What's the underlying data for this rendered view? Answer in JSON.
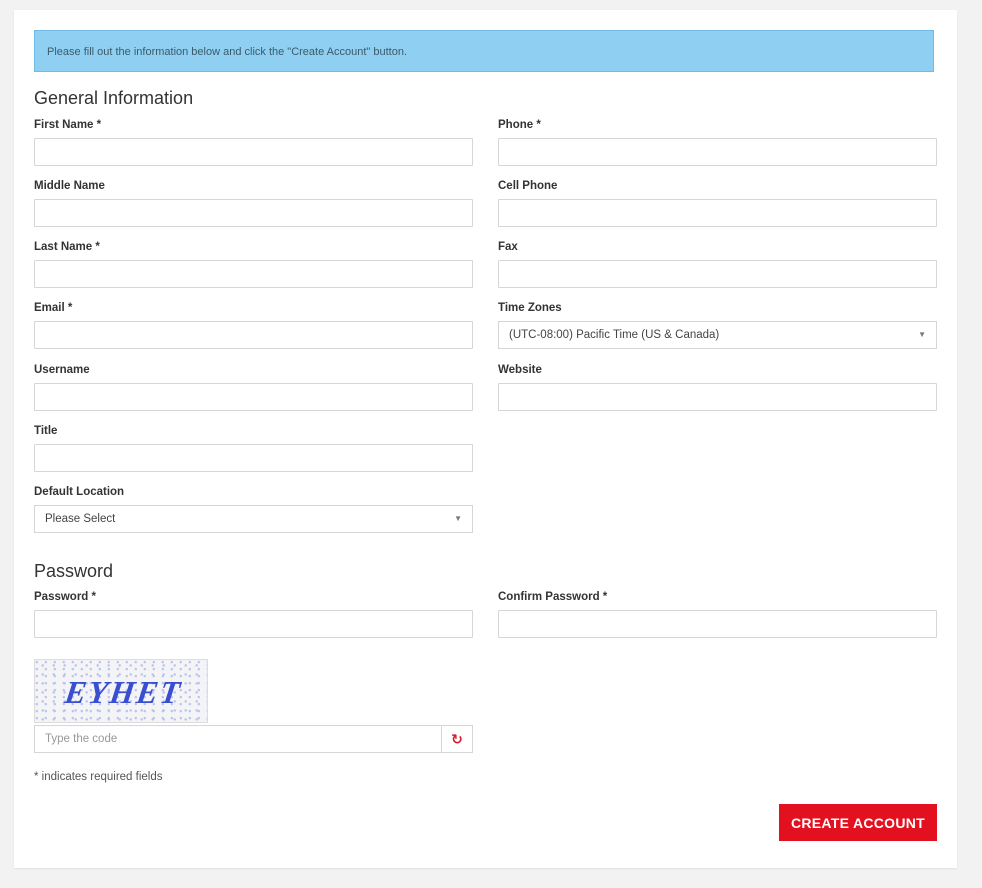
{
  "notice": "Please fill out the information below and click the \"Create Account\" button.",
  "general_heading": "General Information",
  "fields": {
    "first_name": {
      "label": "First Name *",
      "value": ""
    },
    "middle_name": {
      "label": "Middle Name",
      "value": ""
    },
    "last_name": {
      "label": "Last Name *",
      "value": ""
    },
    "email": {
      "label": "Email *",
      "value": ""
    },
    "username": {
      "label": "Username",
      "value": ""
    },
    "title": {
      "label": "Title",
      "value": ""
    },
    "default_location": {
      "label": "Default Location",
      "selected": "Please Select"
    },
    "phone": {
      "label": "Phone *",
      "value": ""
    },
    "cell_phone": {
      "label": "Cell Phone",
      "value": ""
    },
    "fax": {
      "label": "Fax",
      "value": ""
    },
    "time_zones": {
      "label": "Time Zones",
      "selected": "(UTC-08:00) Pacific Time (US & Canada)"
    },
    "website": {
      "label": "Website",
      "value": ""
    }
  },
  "password_heading": "Password",
  "password": {
    "label": "Password *",
    "value": ""
  },
  "confirm_password": {
    "label": "Confirm Password *",
    "value": ""
  },
  "captcha": {
    "image_text": "EYHET",
    "placeholder": "Type the code",
    "refresh_icon": "refresh-icon"
  },
  "required_note": "* indicates required fields",
  "create_button": "CREATE ACCOUNT",
  "colors": {
    "notice_bg": "#8fd0f2",
    "accent": "#e3101f"
  }
}
